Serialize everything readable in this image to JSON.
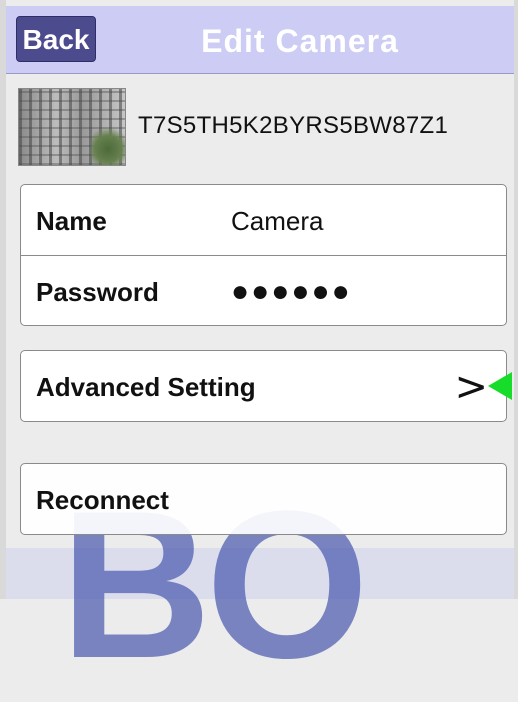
{
  "nav": {
    "back_label": "Back",
    "title": "Edit Camera"
  },
  "camera": {
    "uid": "T7S5TH5K2BYRS5BW87Z1"
  },
  "form": {
    "name_label": "Name",
    "name_value": "Camera",
    "password_label": "Password",
    "password_value": "●●●●●●"
  },
  "advanced": {
    "label": "Advanced Setting",
    "chevron": ">"
  },
  "reconnect": {
    "label": "Reconnect"
  },
  "watermark": {
    "text": "BO"
  },
  "icons": {
    "chevron": "chevron-right-icon",
    "annotation": "green-arrow-icon"
  },
  "colors": {
    "nav_bg": "#ccccf4",
    "back_button": "#4b4b8e",
    "annotation_arrow": "#18dc2a"
  }
}
